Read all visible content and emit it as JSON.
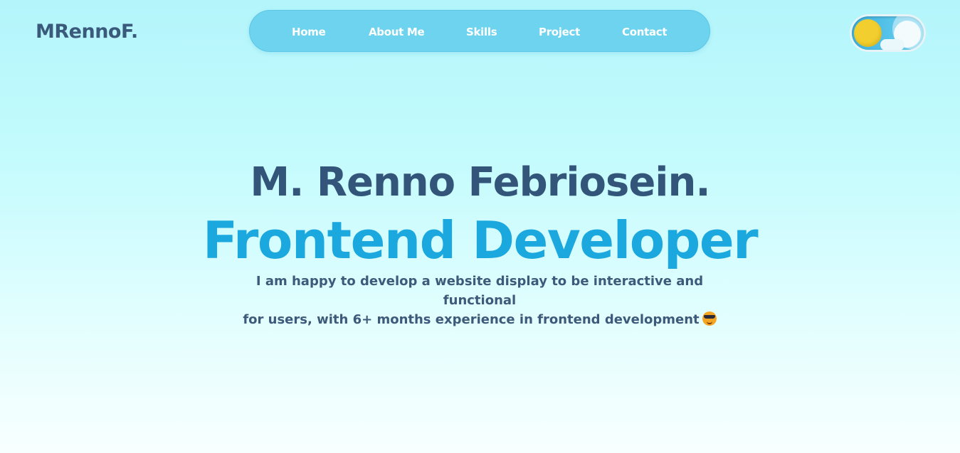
{
  "header": {
    "logo": "MRennoF."
  },
  "nav": {
    "items": [
      {
        "label": "Home"
      },
      {
        "label": "About Me"
      },
      {
        "label": "Skills"
      },
      {
        "label": "Project"
      },
      {
        "label": "Contact"
      }
    ]
  },
  "theme_toggle": {
    "state": "light",
    "icon": "sun-icon"
  },
  "hero": {
    "name": "M. Renno Febriosein.",
    "role": "Frontend Developer",
    "description_line1": "I am happy to develop a website display to be interactive and functional",
    "description_line2": "for users, with 6+ months experience in frontend development",
    "emoji": "smiling-face-with-sunglasses-icon"
  },
  "colors": {
    "accent": "#1aa8df",
    "text_dark": "#33557a",
    "nav_bg": "#6dd3ee",
    "sun": "#f2cf2e"
  }
}
